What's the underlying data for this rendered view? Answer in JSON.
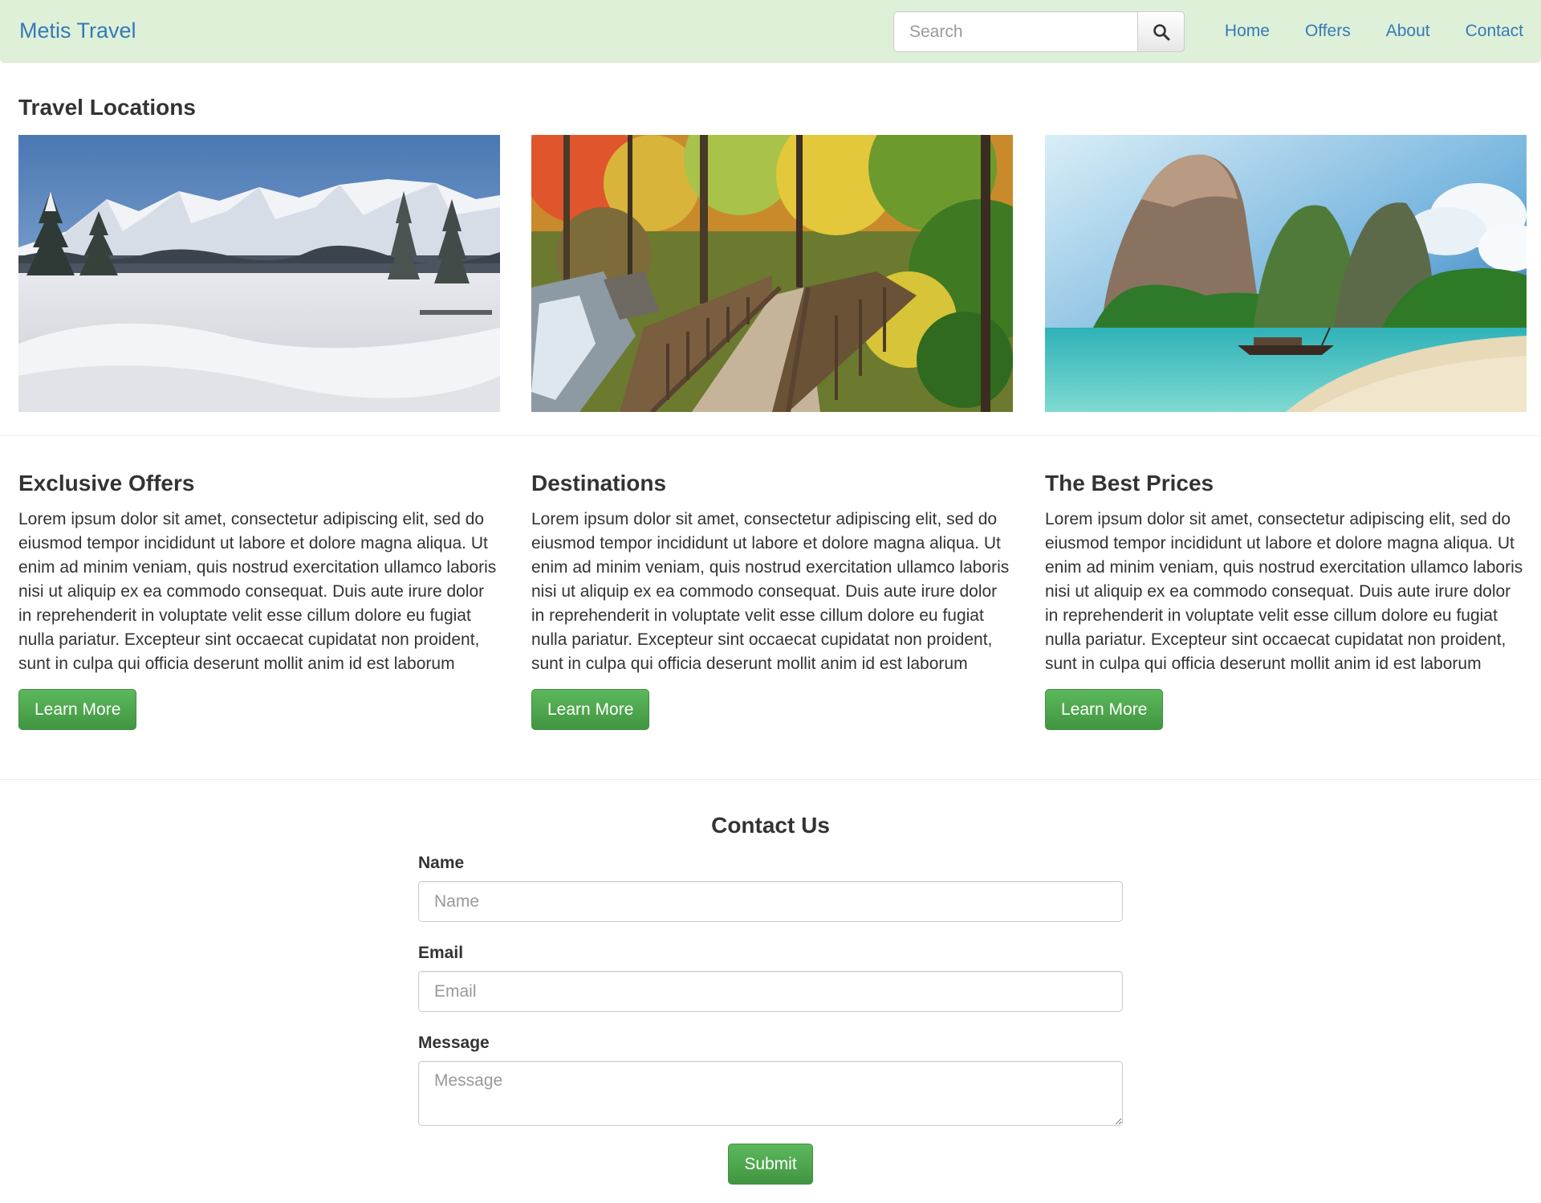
{
  "navbar": {
    "brand": "Metis Travel",
    "search_placeholder": "Search",
    "links": [
      "Home",
      "Offers",
      "About",
      "Contact"
    ]
  },
  "locations": {
    "title": "Travel Locations",
    "photos": [
      "snowy-mountains-photo",
      "autumn-forest-boardwalk-photo",
      "tropical-beach-cliff-photo"
    ]
  },
  "features": [
    {
      "title": "Exclusive Offers",
      "body": "Lorem ipsum dolor sit amet, consectetur adipiscing elit, sed do eiusmod tempor incididunt ut labore et dolore magna aliqua. Ut enim ad minim veniam, quis nostrud exercitation ullamco laboris nisi ut aliquip ex ea commodo consequat. Duis aute irure dolor in reprehenderit in voluptate velit esse cillum dolore eu fugiat nulla pariatur. Excepteur sint occaecat cupidatat non proident, sunt in culpa qui officia deserunt mollit anim id est laborum",
      "button": "Learn More"
    },
    {
      "title": "Destinations",
      "body": "Lorem ipsum dolor sit amet, consectetur adipiscing elit, sed do eiusmod tempor incididunt ut labore et dolore magna aliqua. Ut enim ad minim veniam, quis nostrud exercitation ullamco laboris nisi ut aliquip ex ea commodo consequat. Duis aute irure dolor in reprehenderit in voluptate velit esse cillum dolore eu fugiat nulla pariatur. Excepteur sint occaecat cupidatat non proident, sunt in culpa qui officia deserunt mollit anim id est laborum",
      "button": "Learn More"
    },
    {
      "title": "The Best Prices",
      "body": "Lorem ipsum dolor sit amet, consectetur adipiscing elit, sed do eiusmod tempor incididunt ut labore et dolore magna aliqua. Ut enim ad minim veniam, quis nostrud exercitation ullamco laboris nisi ut aliquip ex ea commodo consequat. Duis aute irure dolor in reprehenderit in voluptate velit esse cillum dolore eu fugiat nulla pariatur. Excepteur sint occaecat cupidatat non proident, sunt in culpa qui officia deserunt mollit anim id est laborum",
      "button": "Learn More"
    }
  ],
  "contact": {
    "title": "Contact Us",
    "name_label": "Name",
    "name_placeholder": "Name",
    "email_label": "Email",
    "email_placeholder": "Email",
    "message_label": "Message",
    "message_placeholder": "Message",
    "submit": "Submit"
  },
  "colors": {
    "navbar_bg": "#dff0d8",
    "link": "#337ab7",
    "button_green": "#5cb85c"
  }
}
